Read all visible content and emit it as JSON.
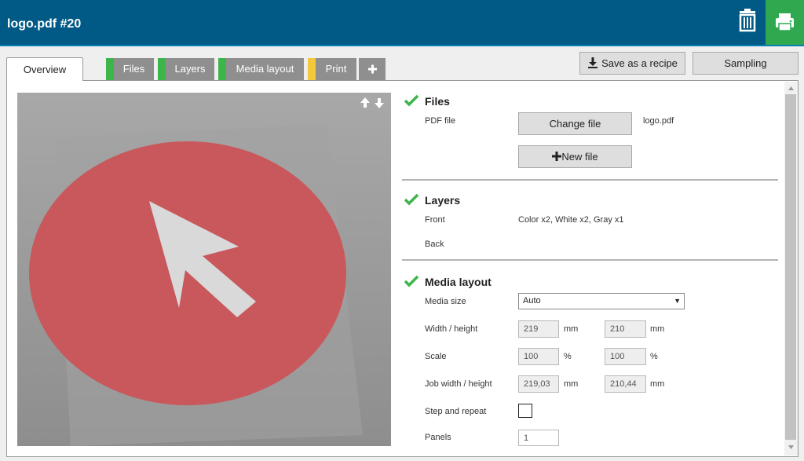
{
  "header": {
    "title": "logo.pdf #20"
  },
  "icons": {
    "trash": "trash-icon",
    "print": "printer-icon",
    "swap": "swap-up-down-icon",
    "check": "check-icon",
    "plus": "plus-icon",
    "download": "download-icon"
  },
  "tabs": [
    {
      "label": "Overview",
      "active": true
    },
    {
      "label": "Files",
      "status_color": "#3db54a"
    },
    {
      "label": "Layers",
      "status_color": "#3db54a"
    },
    {
      "label": "Media layout",
      "status_color": "#3db54a"
    },
    {
      "label": "Print",
      "status_color": "#f5c83c"
    }
  ],
  "toolbar": {
    "save_recipe": "Save as a recipe",
    "sampling": "Sampling"
  },
  "files": {
    "title": "Files",
    "pdf_label": "PDF file",
    "change_button": "Change file",
    "filename": "logo.pdf",
    "new_button": "New file"
  },
  "layers": {
    "title": "Layers",
    "front_label": "Front",
    "front_value": "Color x2, White x2, Gray x1",
    "back_label": "Back"
  },
  "media": {
    "title": "Media layout",
    "media_size_label": "Media size",
    "media_size_value": "Auto",
    "wh_label": "Width / height",
    "width": "219",
    "height": "210",
    "mm": "mm",
    "scale_label": "Scale",
    "scale_x": "100",
    "scale_y": "100",
    "percent": "%",
    "job_label": "Job width / height",
    "job_width": "219,03",
    "job_height": "210,44",
    "step_label": "Step and repeat",
    "panels_label": "Panels",
    "panels_value": "1"
  },
  "colors": {
    "header": "#005a85",
    "print_button": "#2fa84f",
    "check": "#3db54a",
    "logo_red": "#c9585c"
  }
}
